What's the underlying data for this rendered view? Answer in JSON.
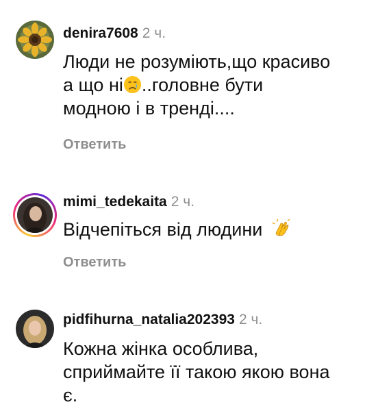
{
  "comments": [
    {
      "username": "denira7608",
      "time": "2 ч.",
      "text_line1": "Люди не розуміють,що красиво",
      "text_line2a": "а що ні",
      "text_line2b": "..головне бути",
      "text_line3": "модною і в тренді....",
      "emoji": "crying-face-emoji",
      "reply_label": "Ответить",
      "has_story_ring": false
    },
    {
      "username": "mimi_tedekaita",
      "time": "2 ч.",
      "text": "Відчепіться від людини",
      "emoji": "clapping-hands-emoji",
      "reply_label": "Ответить",
      "has_story_ring": true
    },
    {
      "username": "pidfihurna_natalia202393",
      "time": "2 ч.",
      "text_line1": "Кожна жінка особлива,",
      "text_line2": "сприймайте її такою якою вона",
      "text_line3": "є.",
      "has_story_ring": false
    }
  ],
  "colors": {
    "text": "#111111",
    "secondary": "#8e8e8e",
    "story_ring_start": "#f9ce34",
    "story_ring_mid": "#ee2a7b",
    "story_ring_end": "#6228d7"
  }
}
